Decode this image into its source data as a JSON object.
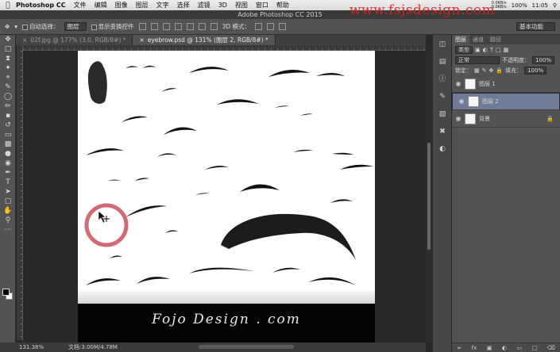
{
  "menubar": {
    "apple": "",
    "app_name": "Photoshop CC",
    "items": [
      "文件",
      "编辑",
      "图像",
      "图层",
      "文字",
      "选择",
      "滤镜",
      "3D",
      "视图",
      "窗口",
      "帮助"
    ],
    "net_up": "0.0KB/s",
    "net_down": "0.0KB/s",
    "battery": "100%",
    "clock": "11:05",
    "search_icon": "search-icon"
  },
  "titlebar": {
    "title": "Adobe Photoshop CC 2015"
  },
  "watermark": {
    "text": "www.fsjsdesign.com"
  },
  "options": {
    "auto_select_label": "自动选择：",
    "auto_select_value": "图层",
    "show_transform_label": "显示变换控件",
    "mode_3d_label": "3D 模式：",
    "workspace": "基本功能"
  },
  "tabs": [
    {
      "label": "02f.jpg @ 177% (3.0, RGB/8#) *"
    },
    {
      "label": "eyebrow.psd @ 131% (图层 2, RGB/8#) *"
    }
  ],
  "canvas": {
    "signature": "Fojo Design . com"
  },
  "status": {
    "zoom": "131.38%",
    "doc_size": "文档:3.00M/4.78M"
  },
  "layers_panel": {
    "tabs": [
      "图层",
      "通道",
      "路径"
    ],
    "filter_label": "类型",
    "blend_mode": "正常",
    "opacity_label": "不透明度：",
    "opacity_value": "100%",
    "lock_label": "锁定：",
    "fill_label": "填充：",
    "fill_value": "100%",
    "layers": [
      {
        "name": "图层 1",
        "selected": false,
        "locked": false
      },
      {
        "name": "图层 2",
        "selected": true,
        "locked": false
      },
      {
        "name": "背景",
        "selected": false,
        "locked": true
      }
    ],
    "footer_icons": [
      "link-icon",
      "fx-icon",
      "mask-icon",
      "adjustment-icon",
      "folder-icon",
      "new-layer-icon",
      "trash-icon"
    ]
  },
  "colors": {
    "selection_circle": "#c94f5e",
    "selected_layer": "#6f7c96",
    "watermark": "#e02020"
  }
}
